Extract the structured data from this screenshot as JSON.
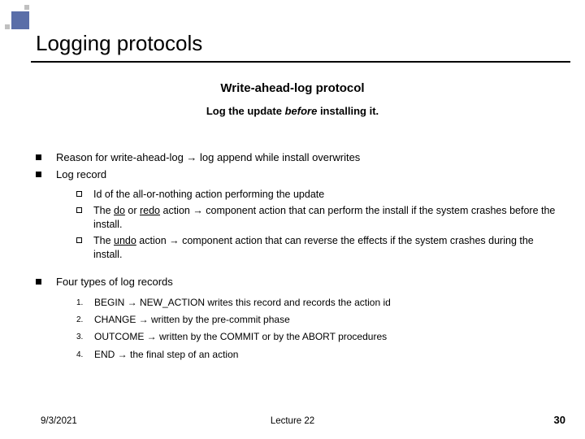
{
  "title": "Logging protocols",
  "subtitle": {
    "line1": "Write-ahead-log protocol",
    "line2_prefix": "Log the update ",
    "line2_italic": "before ",
    "line2_suffix": "installing it."
  },
  "bullets": {
    "b1": "Reason for write-ahead-log → log append while install overwrites",
    "b2": "Log record",
    "b3": "Four types of log records"
  },
  "sub": {
    "s1": "Id of the all-or-nothing action performing the update",
    "s2a": "The ",
    "s2_do": "do",
    "s2b": " or ",
    "s2_redo": "redo",
    "s2c": " action → component action that can perform the install if the system crashes before the install.",
    "s3a": "The ",
    "s3_undo": "undo",
    "s3b": " action → component action that can reverse the effects if the system crashes during the install."
  },
  "num": {
    "n1": "1.",
    "n2": "2.",
    "n3": "3.",
    "n4": "4.",
    "t1": "BEGIN → NEW_ACTION writes this record and records the action  id",
    "t2": "CHANGE → written by  the pre-commit phase",
    "t3": "OUTCOME → written by the COMMIT or by the ABORT procedures",
    "t4": "END → the final step of an action"
  },
  "footer": {
    "date": "9/3/2021",
    "center": "Lecture 22",
    "page": "30"
  }
}
